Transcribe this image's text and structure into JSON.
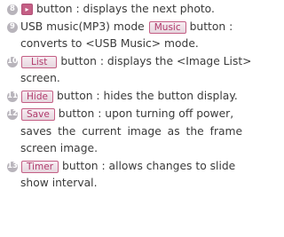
{
  "items": [
    {
      "number": "8",
      "button_label": "▸",
      "text": "button : displays the next photo."
    },
    {
      "number": "9",
      "text_before": "USB music(MP3) mode",
      "button_label": "Music",
      "text": "button :",
      "continuation": "converts to <USB Music> mode."
    },
    {
      "number": "10",
      "button_label": "List",
      "text": "button : displays the <Image List>",
      "continuation": "screen."
    },
    {
      "number": "11",
      "button_label": "Hide",
      "text": "button : hides the button display."
    },
    {
      "number": "12",
      "button_label": "Save",
      "text": "button : upon turning off power,",
      "continuation_lines": [
        "saves the current image as the frame",
        "screen image."
      ]
    },
    {
      "number": "13",
      "button_label": "Timer",
      "text": "button : allows changes to slide",
      "continuation": "show interval."
    }
  ]
}
